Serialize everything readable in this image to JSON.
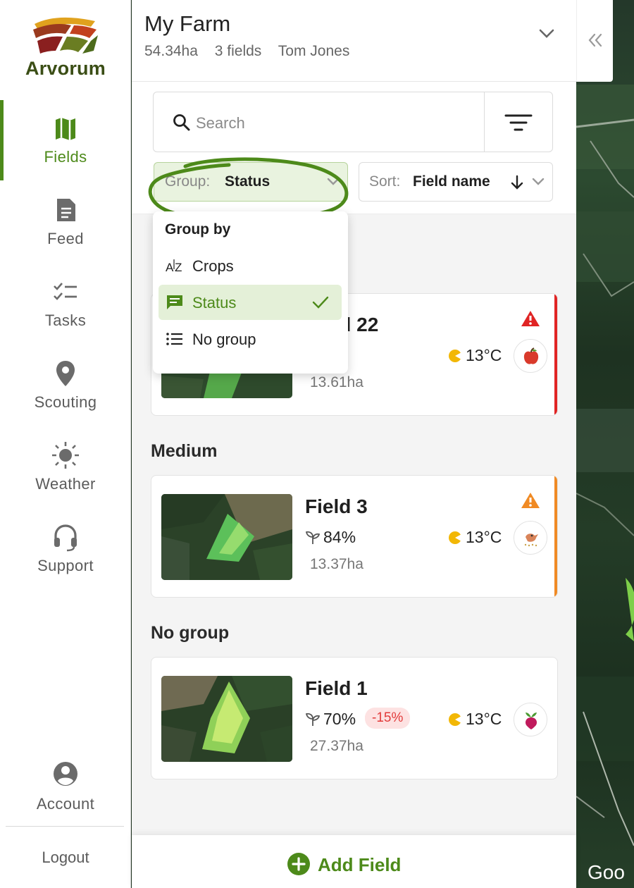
{
  "brand": {
    "name": "Arvorum"
  },
  "nav": {
    "items": [
      {
        "key": "fields",
        "label": "Fields",
        "icon": "map-icon",
        "active": true
      },
      {
        "key": "feed",
        "label": "Feed",
        "icon": "document-icon",
        "active": false
      },
      {
        "key": "tasks",
        "label": "Tasks",
        "icon": "checklist-icon",
        "active": false
      },
      {
        "key": "scouting",
        "label": "Scouting",
        "icon": "location-pin-icon",
        "active": false
      },
      {
        "key": "weather",
        "label": "Weather",
        "icon": "sun-icon",
        "active": false
      },
      {
        "key": "support",
        "label": "Support",
        "icon": "headset-icon",
        "active": false
      },
      {
        "key": "account",
        "label": "Account",
        "icon": "account-icon",
        "active": false
      }
    ],
    "logout_label": "Logout"
  },
  "farm": {
    "name": "My Farm",
    "area": "54.34ha",
    "field_count": "3 fields",
    "owner": "Tom Jones"
  },
  "search": {
    "placeholder": "Search",
    "value": ""
  },
  "group_select": {
    "prefix": "Group:",
    "value": "Status"
  },
  "sort_select": {
    "prefix": "Sort:",
    "value": "Field name"
  },
  "group_menu": {
    "title": "Group by",
    "options": [
      {
        "label": "Crops",
        "icon": "az-sort-icon",
        "selected": false
      },
      {
        "label": "Status",
        "icon": "message-icon",
        "selected": true
      },
      {
        "label": "No group",
        "icon": "list-icon",
        "selected": false
      }
    ]
  },
  "groups": [
    {
      "heading": "",
      "fields": [
        {
          "name": "Field 22",
          "health": "%",
          "delta": "",
          "area": "13.61ha",
          "temp": "13°C",
          "crop_icon": "apple-icon",
          "status_color": "#e02424",
          "warn_color": "#e02424"
        }
      ]
    },
    {
      "heading": "Medium",
      "fields": [
        {
          "name": "Field 3",
          "health": "84%",
          "delta": "",
          "area": "13.37ha",
          "temp": "13°C",
          "crop_icon": "bird-seed-icon",
          "status_color": "#f08a24",
          "warn_color": "#f08a24"
        }
      ]
    },
    {
      "heading": "No group",
      "fields": [
        {
          "name": "Field 1",
          "health": "70%",
          "delta": "-15%",
          "area": "27.37ha",
          "temp": "13°C",
          "crop_icon": "beetroot-icon",
          "status_color": "",
          "warn_color": ""
        }
      ]
    }
  ],
  "add_field_label": "Add Field",
  "map": {
    "attribution": "Goo"
  },
  "colors": {
    "accent": "#4d8a1a",
    "danger": "#e02424",
    "warning": "#f08a24",
    "selected_bg": "#e4f0d8"
  }
}
